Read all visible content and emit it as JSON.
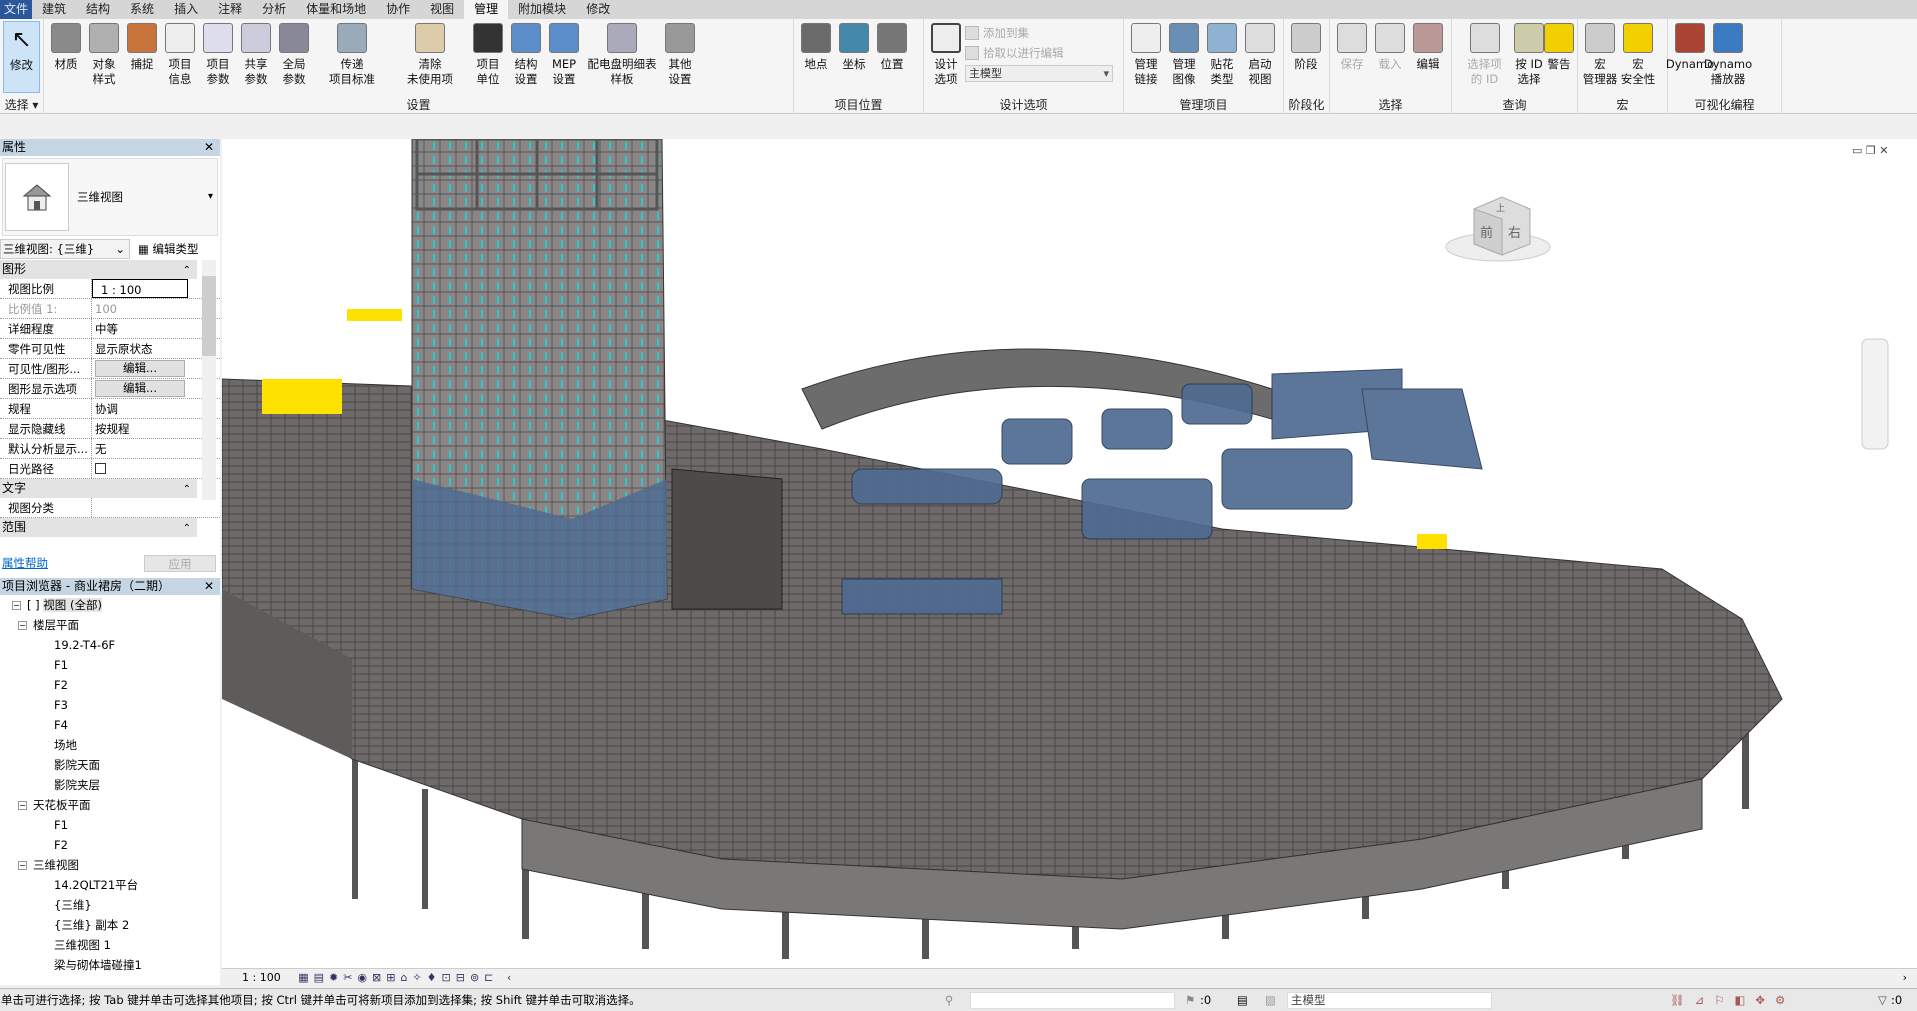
{
  "tabs": [
    "文件",
    "建筑",
    "结构",
    "系统",
    "插入",
    "注释",
    "分析",
    "体量和场地",
    "协作",
    "视图",
    "管理",
    "附加模块",
    "修改"
  ],
  "active_tab": "管理",
  "ribbon": {
    "select": {
      "label": "选择",
      "buttons": [
        {
          "l1": "修改",
          "l2": ""
        }
      ]
    },
    "settings": {
      "label": "设置",
      "buttons": [
        {
          "l1": "材质",
          "l2": ""
        },
        {
          "l1": "对象",
          "l2": "样式"
        },
        {
          "l1": "捕捉",
          "l2": ""
        },
        {
          "l1": "项目",
          "l2": "信息"
        },
        {
          "l1": "项目",
          "l2": "参数"
        },
        {
          "l1": "共享",
          "l2": "参数"
        },
        {
          "l1": "全局",
          "l2": "参数"
        },
        {
          "l1": "传递",
          "l2": "项目标准"
        },
        {
          "l1": "清除",
          "l2": "未使用项"
        },
        {
          "l1": "项目",
          "l2": "单位"
        },
        {
          "l1": "结构",
          "l2": "设置"
        },
        {
          "l1": "MEP",
          "l2": "设置"
        },
        {
          "l1": "配电盘明细表",
          "l2": "样板"
        },
        {
          "l1": "其他",
          "l2": "设置"
        }
      ]
    },
    "location": {
      "label": "项目位置",
      "buttons": [
        {
          "l1": "地点",
          "l2": ""
        },
        {
          "l1": "坐标",
          "l2": ""
        },
        {
          "l1": "位置",
          "l2": ""
        }
      ]
    },
    "design_options": {
      "label": "设计选项",
      "button": {
        "l1": "设计",
        "l2": "选项"
      },
      "add_to_set": "添加到集",
      "pick_to_edit": "拾取以进行编辑",
      "combo": "主模型"
    },
    "manage_project": {
      "label": "管理项目",
      "buttons": [
        {
          "l1": "管理",
          "l2": "链接"
        },
        {
          "l1": "管理",
          "l2": "图像"
        },
        {
          "l1": "贴花",
          "l2": "类型"
        },
        {
          "l1": "启动",
          "l2": "视图"
        }
      ]
    },
    "phasing": {
      "label": "阶段化",
      "buttons": [
        {
          "l1": "阶段",
          "l2": ""
        }
      ]
    },
    "selection": {
      "label": "选择",
      "buttons": [
        {
          "l1": "保存",
          "l2": ""
        },
        {
          "l1": "载入",
          "l2": ""
        },
        {
          "l1": "编辑",
          "l2": ""
        }
      ]
    },
    "inquiry": {
      "label": "查询",
      "buttons": [
        {
          "l1": "选择项",
          "l2": "的 ID"
        },
        {
          "l1": "按 ID",
          "l2": "选择"
        },
        {
          "l1": "警告",
          "l2": ""
        }
      ]
    },
    "macros": {
      "label": "宏",
      "buttons": [
        {
          "l1": "宏",
          "l2": "管理器"
        },
        {
          "l1": "宏",
          "l2": "安全性"
        }
      ]
    },
    "visual_programming": {
      "label": "可视化编程",
      "buttons": [
        {
          "l1": "Dynamo",
          "l2": ""
        },
        {
          "l1": "Dynamo",
          "l2": "播放器"
        }
      ]
    }
  },
  "properties": {
    "title": "属性",
    "type_name": "三维视图",
    "instance_selector": "三维视图: {三维}",
    "edit_type": "编辑类型",
    "cat_graphics": "图形",
    "cat_text": "文字",
    "cat_extents": "范围",
    "rows": [
      {
        "k": "视图比例",
        "v": "1 : 100"
      },
      {
        "k": "比例值 1:",
        "v": "100"
      },
      {
        "k": "详细程度",
        "v": "中等"
      },
      {
        "k": "零件可见性",
        "v": "显示原状态"
      },
      {
        "k": "可见性/图形...",
        "v": "编辑..."
      },
      {
        "k": "图形显示选项",
        "v": "编辑..."
      },
      {
        "k": "规程",
        "v": "协调"
      },
      {
        "k": "显示隐藏线",
        "v": "按规程"
      },
      {
        "k": "默认分析显示...",
        "v": "无"
      },
      {
        "k": "日光路径",
        "v": ""
      }
    ],
    "text_rows": [
      {
        "k": "视图分类",
        "v": ""
      }
    ],
    "help": "属性帮助",
    "apply": "应用"
  },
  "browser": {
    "title": "项目浏览器 - 商业裙房（二期）",
    "root": "视图 (全部)",
    "groups": [
      {
        "name": "楼层平面",
        "items": [
          "19.2-T4-6F",
          "F1",
          "F2",
          "F3",
          "F4",
          "场地",
          "影院天面",
          "影院夹层"
        ]
      },
      {
        "name": "天花板平面",
        "items": [
          "F1",
          "F2"
        ]
      },
      {
        "name": "三维视图",
        "items": [
          "14.2QLT21平台",
          "{三维}",
          "{三维} 副本 2",
          "三维视图 1",
          "梁与砌体墙碰撞1"
        ]
      }
    ]
  },
  "viewcube": {
    "front": "前",
    "right": "右",
    "top": "上"
  },
  "view_bar": {
    "scale": "1 : 100"
  },
  "status": {
    "message": "单击可进行选择; 按 Tab 键并单击可选择其他项目; 按 Ctrl 键并单击可将新项目添加到选择集; 按 Shift 键并单击可取消选择。",
    "worksets_count": ":0",
    "model": "主模型",
    "filter_count": ":0"
  }
}
